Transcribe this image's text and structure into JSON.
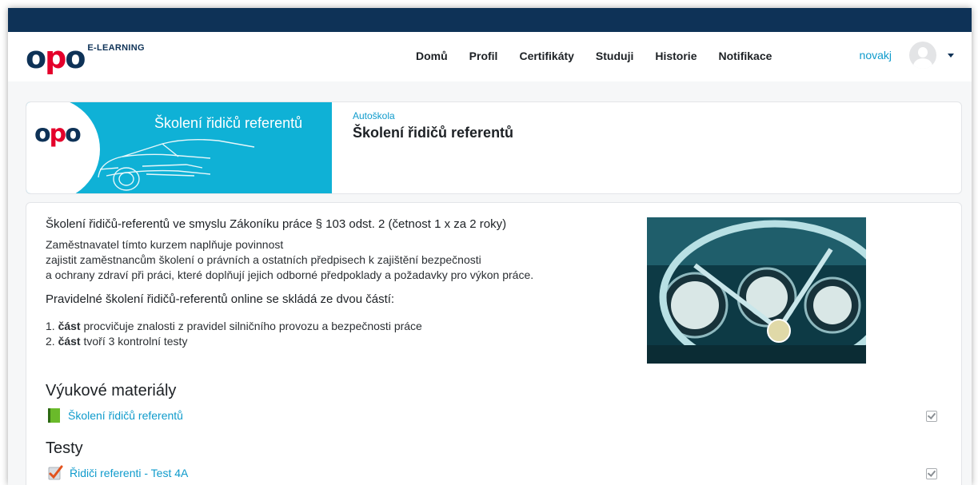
{
  "brand": {
    "logo_text": "opo",
    "tag": "E-LEARNING"
  },
  "nav": {
    "items": [
      {
        "label": "Domů"
      },
      {
        "label": "Profil"
      },
      {
        "label": "Certifikáty"
      },
      {
        "label": "Studuji"
      },
      {
        "label": "Historie"
      },
      {
        "label": "Notifikace"
      }
    ]
  },
  "user": {
    "username": "novakj"
  },
  "course": {
    "banner_title": "Školení řidičů referentů",
    "category": "Autoškola",
    "title": "Školení řidičů referentů"
  },
  "intro": {
    "lead": "Školení řidičů-referentů ve smyslu Zákoníku práce § 103 odst. 2 (četnost 1 x za 2 roky)",
    "lines": [
      "Zaměstnavatel tímto kurzem naplňuje povinnost",
      "zajistit zaměstnancům školení o právních a ostatních předpisech k zajištění bezpečnosti",
      "a ochrany zdraví při práci, které doplňují jejich odborné předpoklady a požadavky pro výkon práce."
    ],
    "subheading": "Pravidelné školení řidičů-referentů online se skládá ze dvou částí:",
    "list": [
      {
        "num": "1.",
        "bold": "část",
        "text": " procvičuje znalosti z pravidel silničního provozu a bezpečnosti práce"
      },
      {
        "num": "2.",
        "bold": "část",
        "text": " tvoří 3 kontrolní testy"
      }
    ]
  },
  "sections": [
    {
      "title": "Výukové materiály",
      "activity": {
        "label": "Školení řidičů referentů",
        "icon": "book-icon"
      }
    },
    {
      "title": "Testy",
      "activity": {
        "label": "Řidiči referenti - Test 4A",
        "icon": "quiz-icon"
      }
    }
  ],
  "colors": {
    "navy": "#0e3257",
    "accent": "#0f9bcc",
    "banner": "#0fb1d6",
    "logo_red": "#e4002b"
  }
}
